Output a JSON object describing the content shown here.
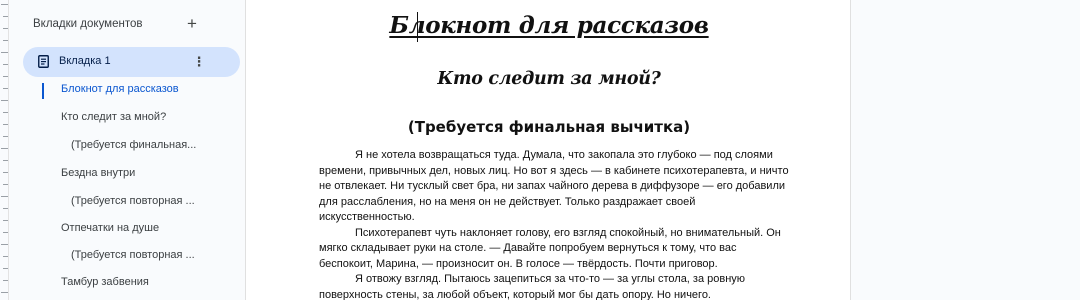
{
  "sidebar": {
    "title": "Вкладки документов",
    "add_label": "+",
    "tab": {
      "label": "Вкладка 1",
      "more_label": "⋮",
      "icon": "document-icon"
    },
    "outline": [
      {
        "label": "Блокнот для рассказов",
        "active": true
      },
      {
        "label": "Кто следит за мной?"
      },
      {
        "label": "(Требуется финальная..."
      },
      {
        "label": "Бездна внутри"
      },
      {
        "label": "(Требуется повторная ..."
      },
      {
        "label": "Отпечатки на душе"
      },
      {
        "label": "(Требуется повторная ..."
      },
      {
        "label": "Тамбур забвения"
      }
    ]
  },
  "document": {
    "title": "Блокнот для рассказов",
    "subtitle": "Кто следит за мной?",
    "note": "(Требуется финальная вычитка)",
    "paragraphs": [
      "Я не хотела возвращаться туда. Думала, что закопала это глубоко — под слоями времени, привычных дел, новых лиц. Но вот я здесь — в кабинете психотерапевта, и ничто не отвлекает. Ни тусклый свет бра, ни запах чайного дерева в диффузоре — его добавили для расслабления, но на меня он не действует. Только раздражает своей искусственностью.",
      "Психотерапевт чуть наклоняет голову, его взгляд спокойный, но внимательный. Он мягко складывает руки на столе. — Давайте попробуем вернуться к тому, что вас беспокоит, Марина, — произносит он. В голосе — твёрдость. Почти приговор.",
      "Я отвожу взгляд. Пытаюсь зацепиться за что-то — за углы стола, за ровную поверхность стены, за любой объект, который мог бы дать опору. Но ничего."
    ]
  }
}
